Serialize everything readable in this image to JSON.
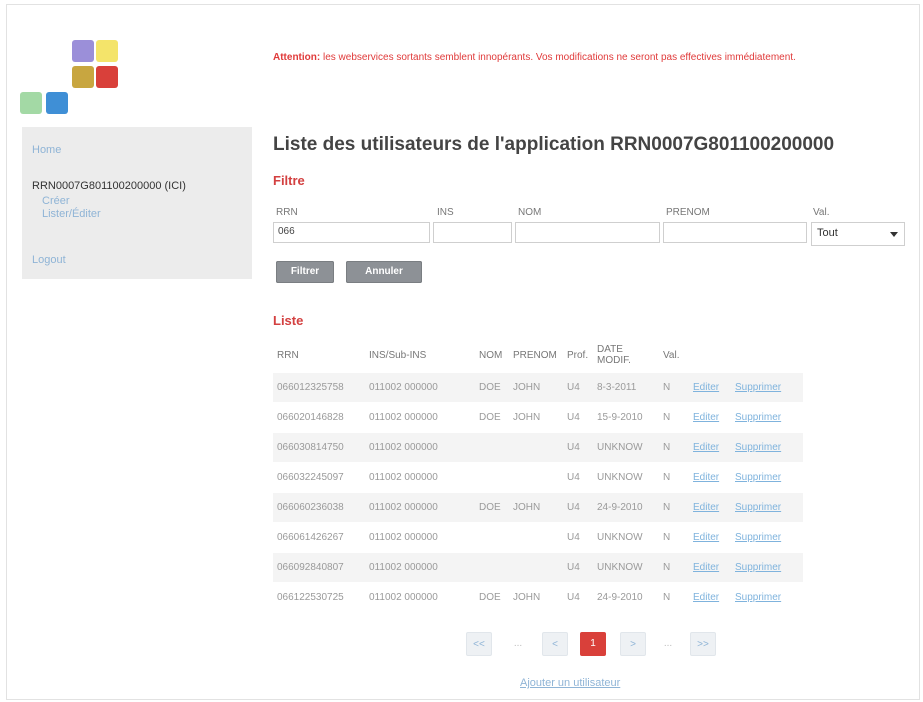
{
  "warning": {
    "prefix": "Attention:",
    "message": "les webservices sortants semblent innopérants. Vos modifications ne seront pas effectives immédiatement."
  },
  "sidebar": {
    "home": "Home",
    "app_name": "RRN0007G801100200000 (ICI)",
    "create": "Créer",
    "list_edit": "Lister/Éditer",
    "logout": "Logout"
  },
  "title": "Liste des utilisateurs de l'application RRN0007G801100200000",
  "filter": {
    "section_title": "Filtre",
    "labels": {
      "rrn": "RRN",
      "ins": "INS",
      "nom": "NOM",
      "prenom": "PRENOM",
      "val": "Val."
    },
    "values": {
      "rrn": "066",
      "ins": "",
      "nom": "",
      "prenom": ""
    },
    "val_selected": "Tout",
    "filter_button": "Filtrer",
    "cancel_button": "Annuler"
  },
  "list": {
    "section_title": "Liste",
    "headers": [
      "RRN",
      "INS/Sub-INS",
      "NOM",
      "PRENOM",
      "Prof.",
      "DATE MODIF.",
      "Val."
    ],
    "rows": [
      [
        "066012325758",
        "011002 000000",
        "DOE",
        "JOHN",
        "U4",
        "8-3-2011",
        "N"
      ],
      [
        "066020146828",
        "011002 000000",
        "DOE",
        "JOHN",
        "U4",
        "15-9-2010",
        "N"
      ],
      [
        "066030814750",
        "011002 000000",
        "",
        "",
        "U4",
        "UNKNOW",
        "N"
      ],
      [
        "066032245097",
        "011002 000000",
        "",
        "",
        "U4",
        "UNKNOW",
        "N"
      ],
      [
        "066060236038",
        "011002 000000",
        "DOE",
        "JOHN",
        "U4",
        "24-9-2010",
        "N"
      ],
      [
        "066061426267",
        "011002 000000",
        "",
        "",
        "U4",
        "UNKNOW",
        "N"
      ],
      [
        "066092840807",
        "011002 000000",
        "",
        "",
        "U4",
        "UNKNOW",
        "N"
      ],
      [
        "066122530725",
        "011002 000000",
        "DOE",
        "JOHN",
        "U4",
        "24-9-2010",
        "N"
      ]
    ],
    "edit_label": "Editer",
    "delete_label": "Supprimer"
  },
  "pagination": {
    "first": "<<",
    "prev": "<",
    "current": "1",
    "next": ">",
    "last": ">>",
    "dots": "..."
  },
  "add_user": "Ajouter un utilisateur",
  "colors": {
    "accent_red": "#d34040",
    "link_blue": "#8fb4d6",
    "button_gray": "#8d9196",
    "logo": [
      "#9b8fd9",
      "#f4e46a",
      "#c8a640",
      "#d9403a",
      "#a3d9a5",
      "#3f8fd6"
    ]
  }
}
